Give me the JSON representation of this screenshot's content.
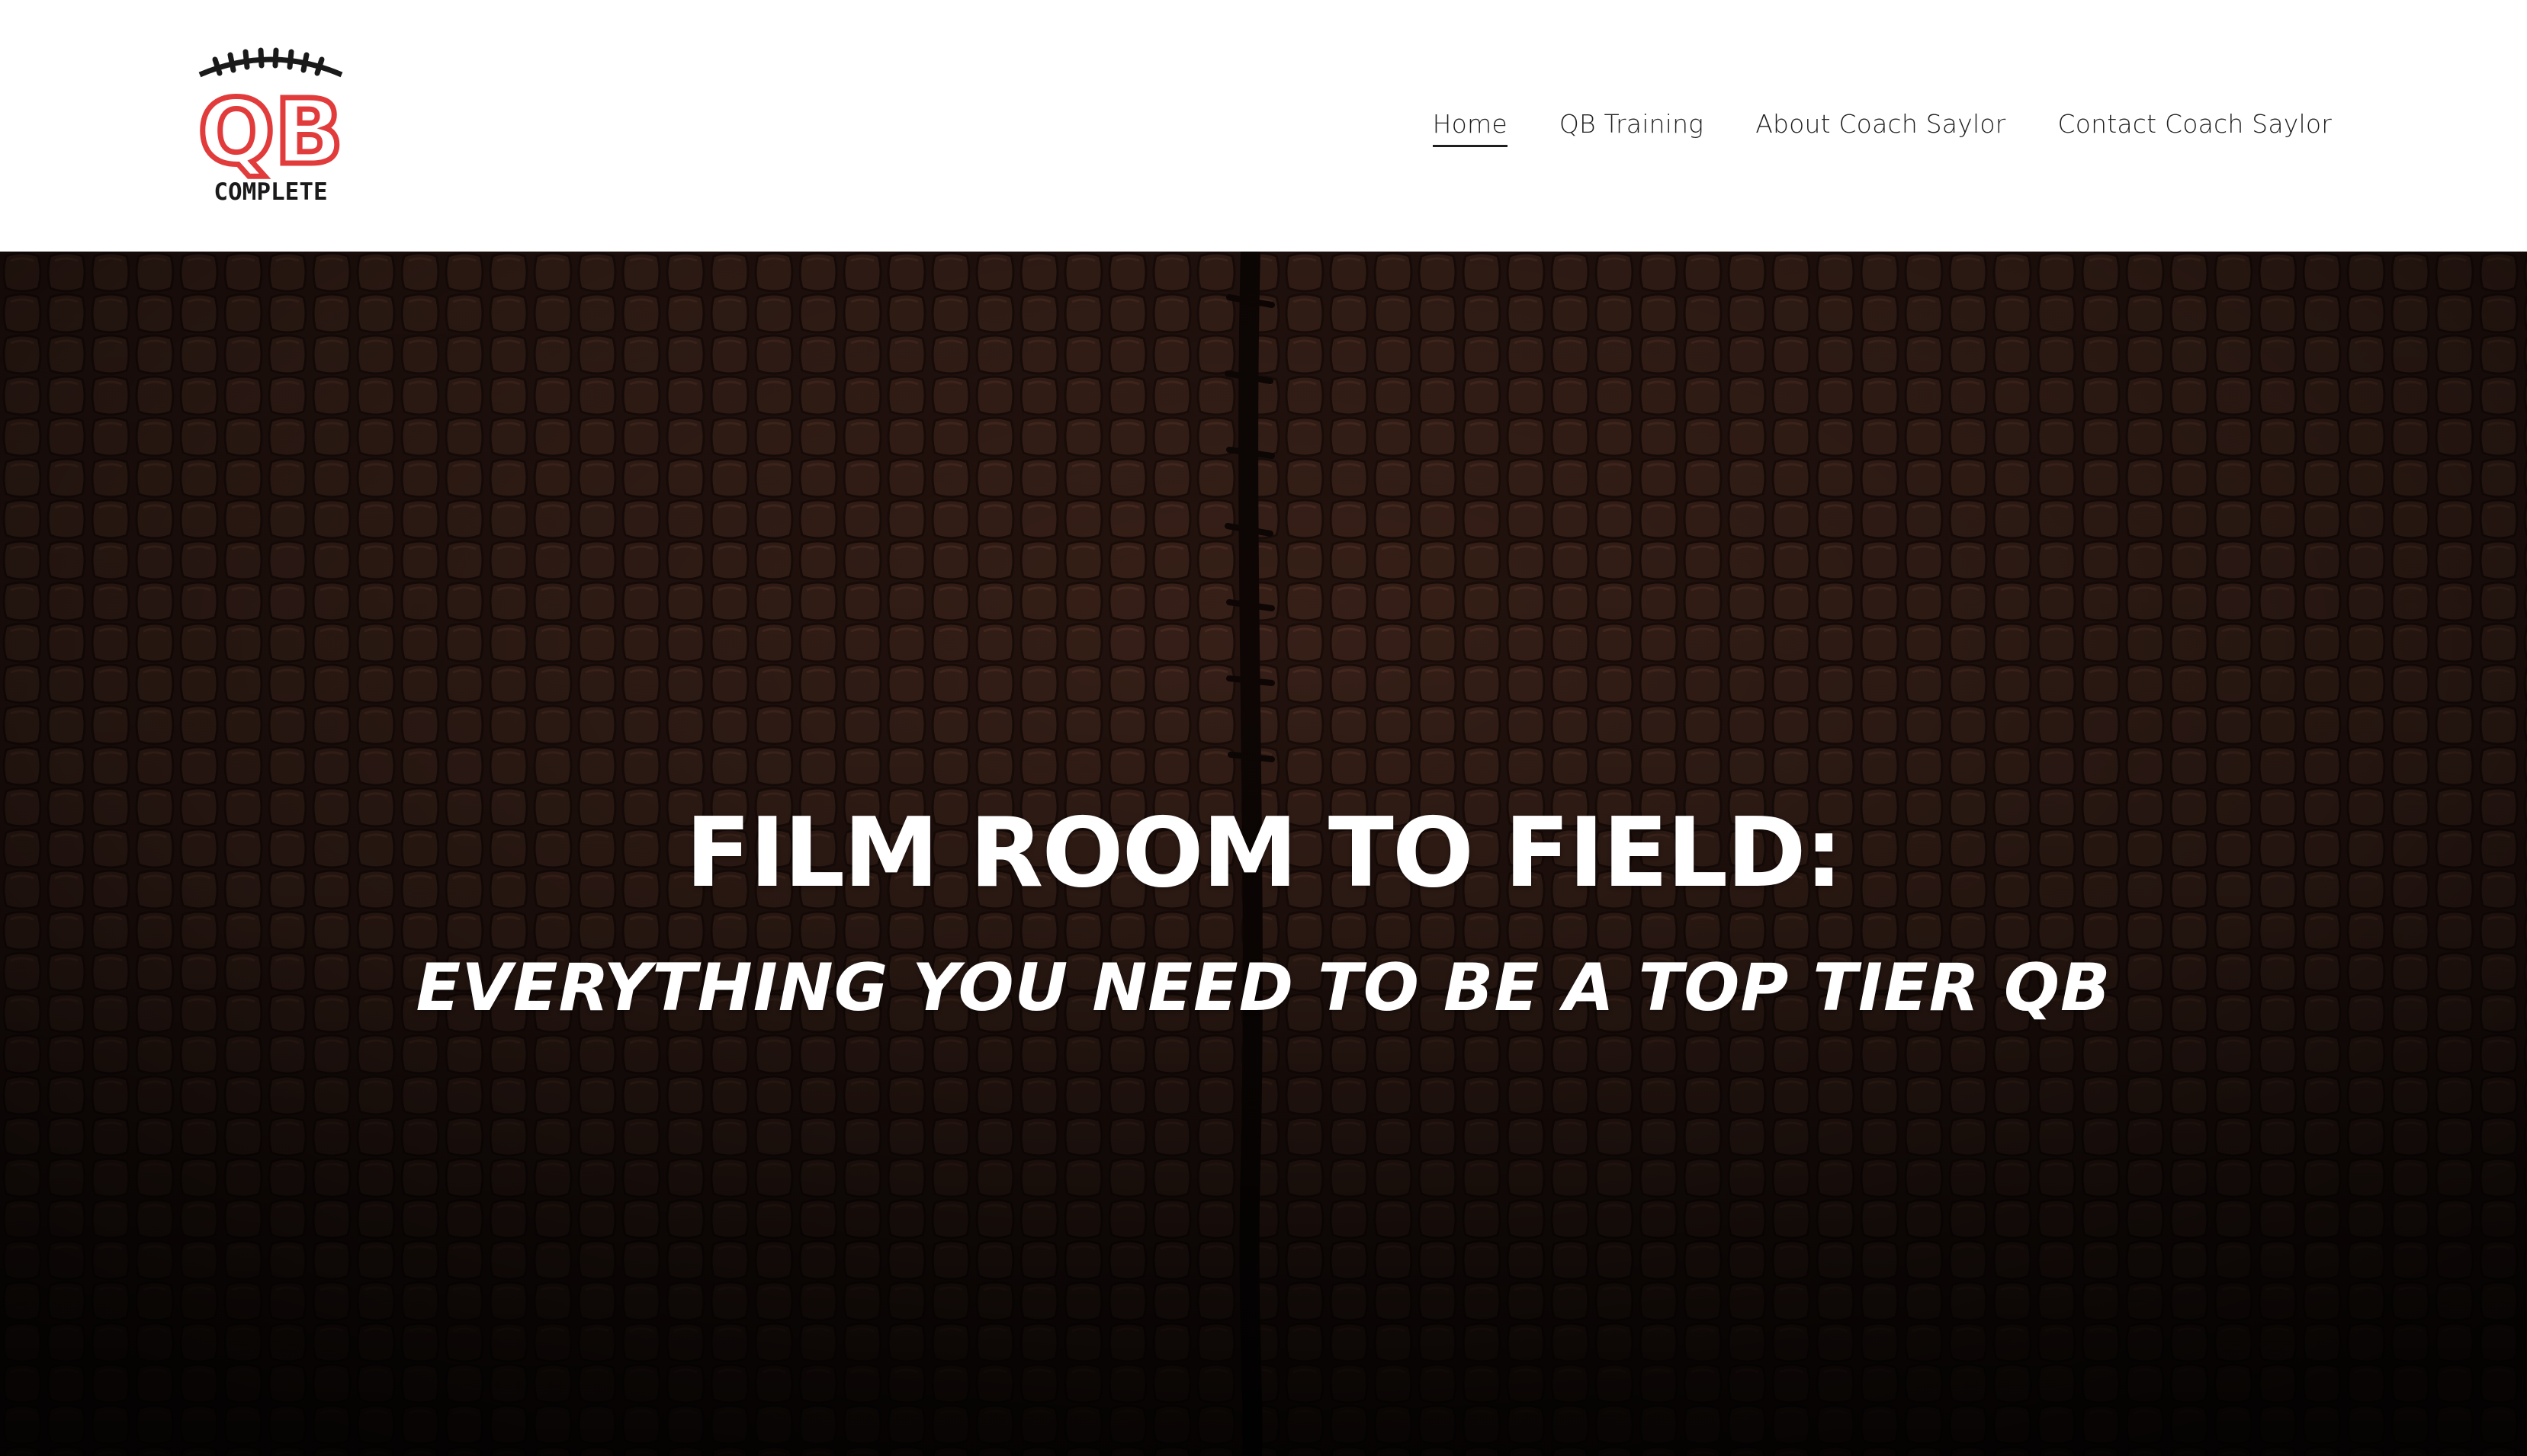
{
  "header": {
    "logo": {
      "text_top": "QB",
      "text_bottom": "COMPLETE",
      "icon": "football-laces-icon",
      "accent_color": "#e23b3b",
      "dark_color": "#1a1a1a"
    },
    "nav": [
      {
        "label": "Home",
        "active": true
      },
      {
        "label": "QB Training",
        "active": false
      },
      {
        "label": "About Coach Saylor",
        "active": false
      },
      {
        "label": "Contact Coach Saylor",
        "active": false
      }
    ]
  },
  "hero": {
    "title": "FILM ROOM TO FIELD:",
    "subtitle": "EVERYTHING YOU NEED TO BE A TOP TIER QB",
    "background": "football-leather-texture",
    "background_color": "#2a1812",
    "text_color": "#ffffff"
  }
}
